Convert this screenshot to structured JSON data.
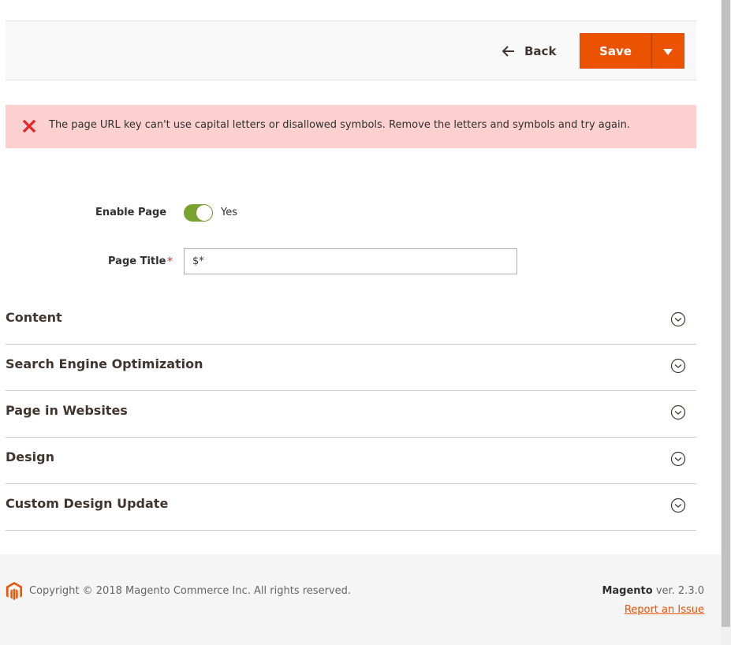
{
  "page_actions": {
    "back_label": "Back",
    "save_label": "Save"
  },
  "error_message": {
    "text": "The page URL key can't use capital letters or disallowed symbols. Remove the letters and symbols and try again."
  },
  "form": {
    "enable_page": {
      "label": "Enable Page",
      "value": true,
      "value_text": "Yes"
    },
    "page_title": {
      "label": "Page Title",
      "required_marker": "*",
      "value": "$*"
    }
  },
  "sections": [
    {
      "title": "Content"
    },
    {
      "title": "Search Engine Optimization"
    },
    {
      "title": "Page in Websites"
    },
    {
      "title": "Design"
    },
    {
      "title": "Custom Design Update"
    }
  ],
  "footer": {
    "copyright": "Copyright © 2018 Magento Commerce Inc. All rights reserved.",
    "brand": "Magento",
    "version": "ver. 2.3.0",
    "report_link": "Report an Issue"
  },
  "colors": {
    "accent": "#eb5202",
    "toggle_on": "#79a22e",
    "error_bg": "#fdd0d0",
    "error_icon": "#e22626"
  }
}
